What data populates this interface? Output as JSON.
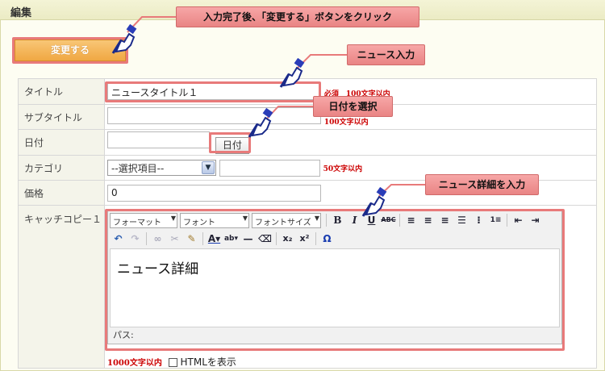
{
  "section": {
    "title": "編集"
  },
  "submit_button": {
    "label": "変更する"
  },
  "callouts": {
    "submit": "入力完了後、「変更する」ボタンをクリック",
    "news_input": "ニュース入力",
    "date_select": "日付を選択",
    "detail_input": "ニュース詳細を入力"
  },
  "form": {
    "title": {
      "label": "タイトル",
      "value": "ニュースタイトル１",
      "note": "必須　100文字以内"
    },
    "subtitle": {
      "label": "サブタイトル",
      "value": "",
      "note": "100文字以内"
    },
    "date": {
      "label": "日付",
      "value": "",
      "button": "日付"
    },
    "category": {
      "label": "カテゴリ",
      "selected": "--選択項目--",
      "value": "",
      "note": "50文字以内"
    },
    "price": {
      "label": "価格",
      "value": "0"
    },
    "catch": {
      "label": "キャッチコピー１",
      "toolbar": {
        "format": "フォーマット",
        "font": "フォント",
        "size": "フォントサイズ"
      },
      "content": "ニュース詳細",
      "path_label": "パス:",
      "note": "1000文字以内",
      "html_toggle_label": "HTMLを表示"
    }
  }
}
